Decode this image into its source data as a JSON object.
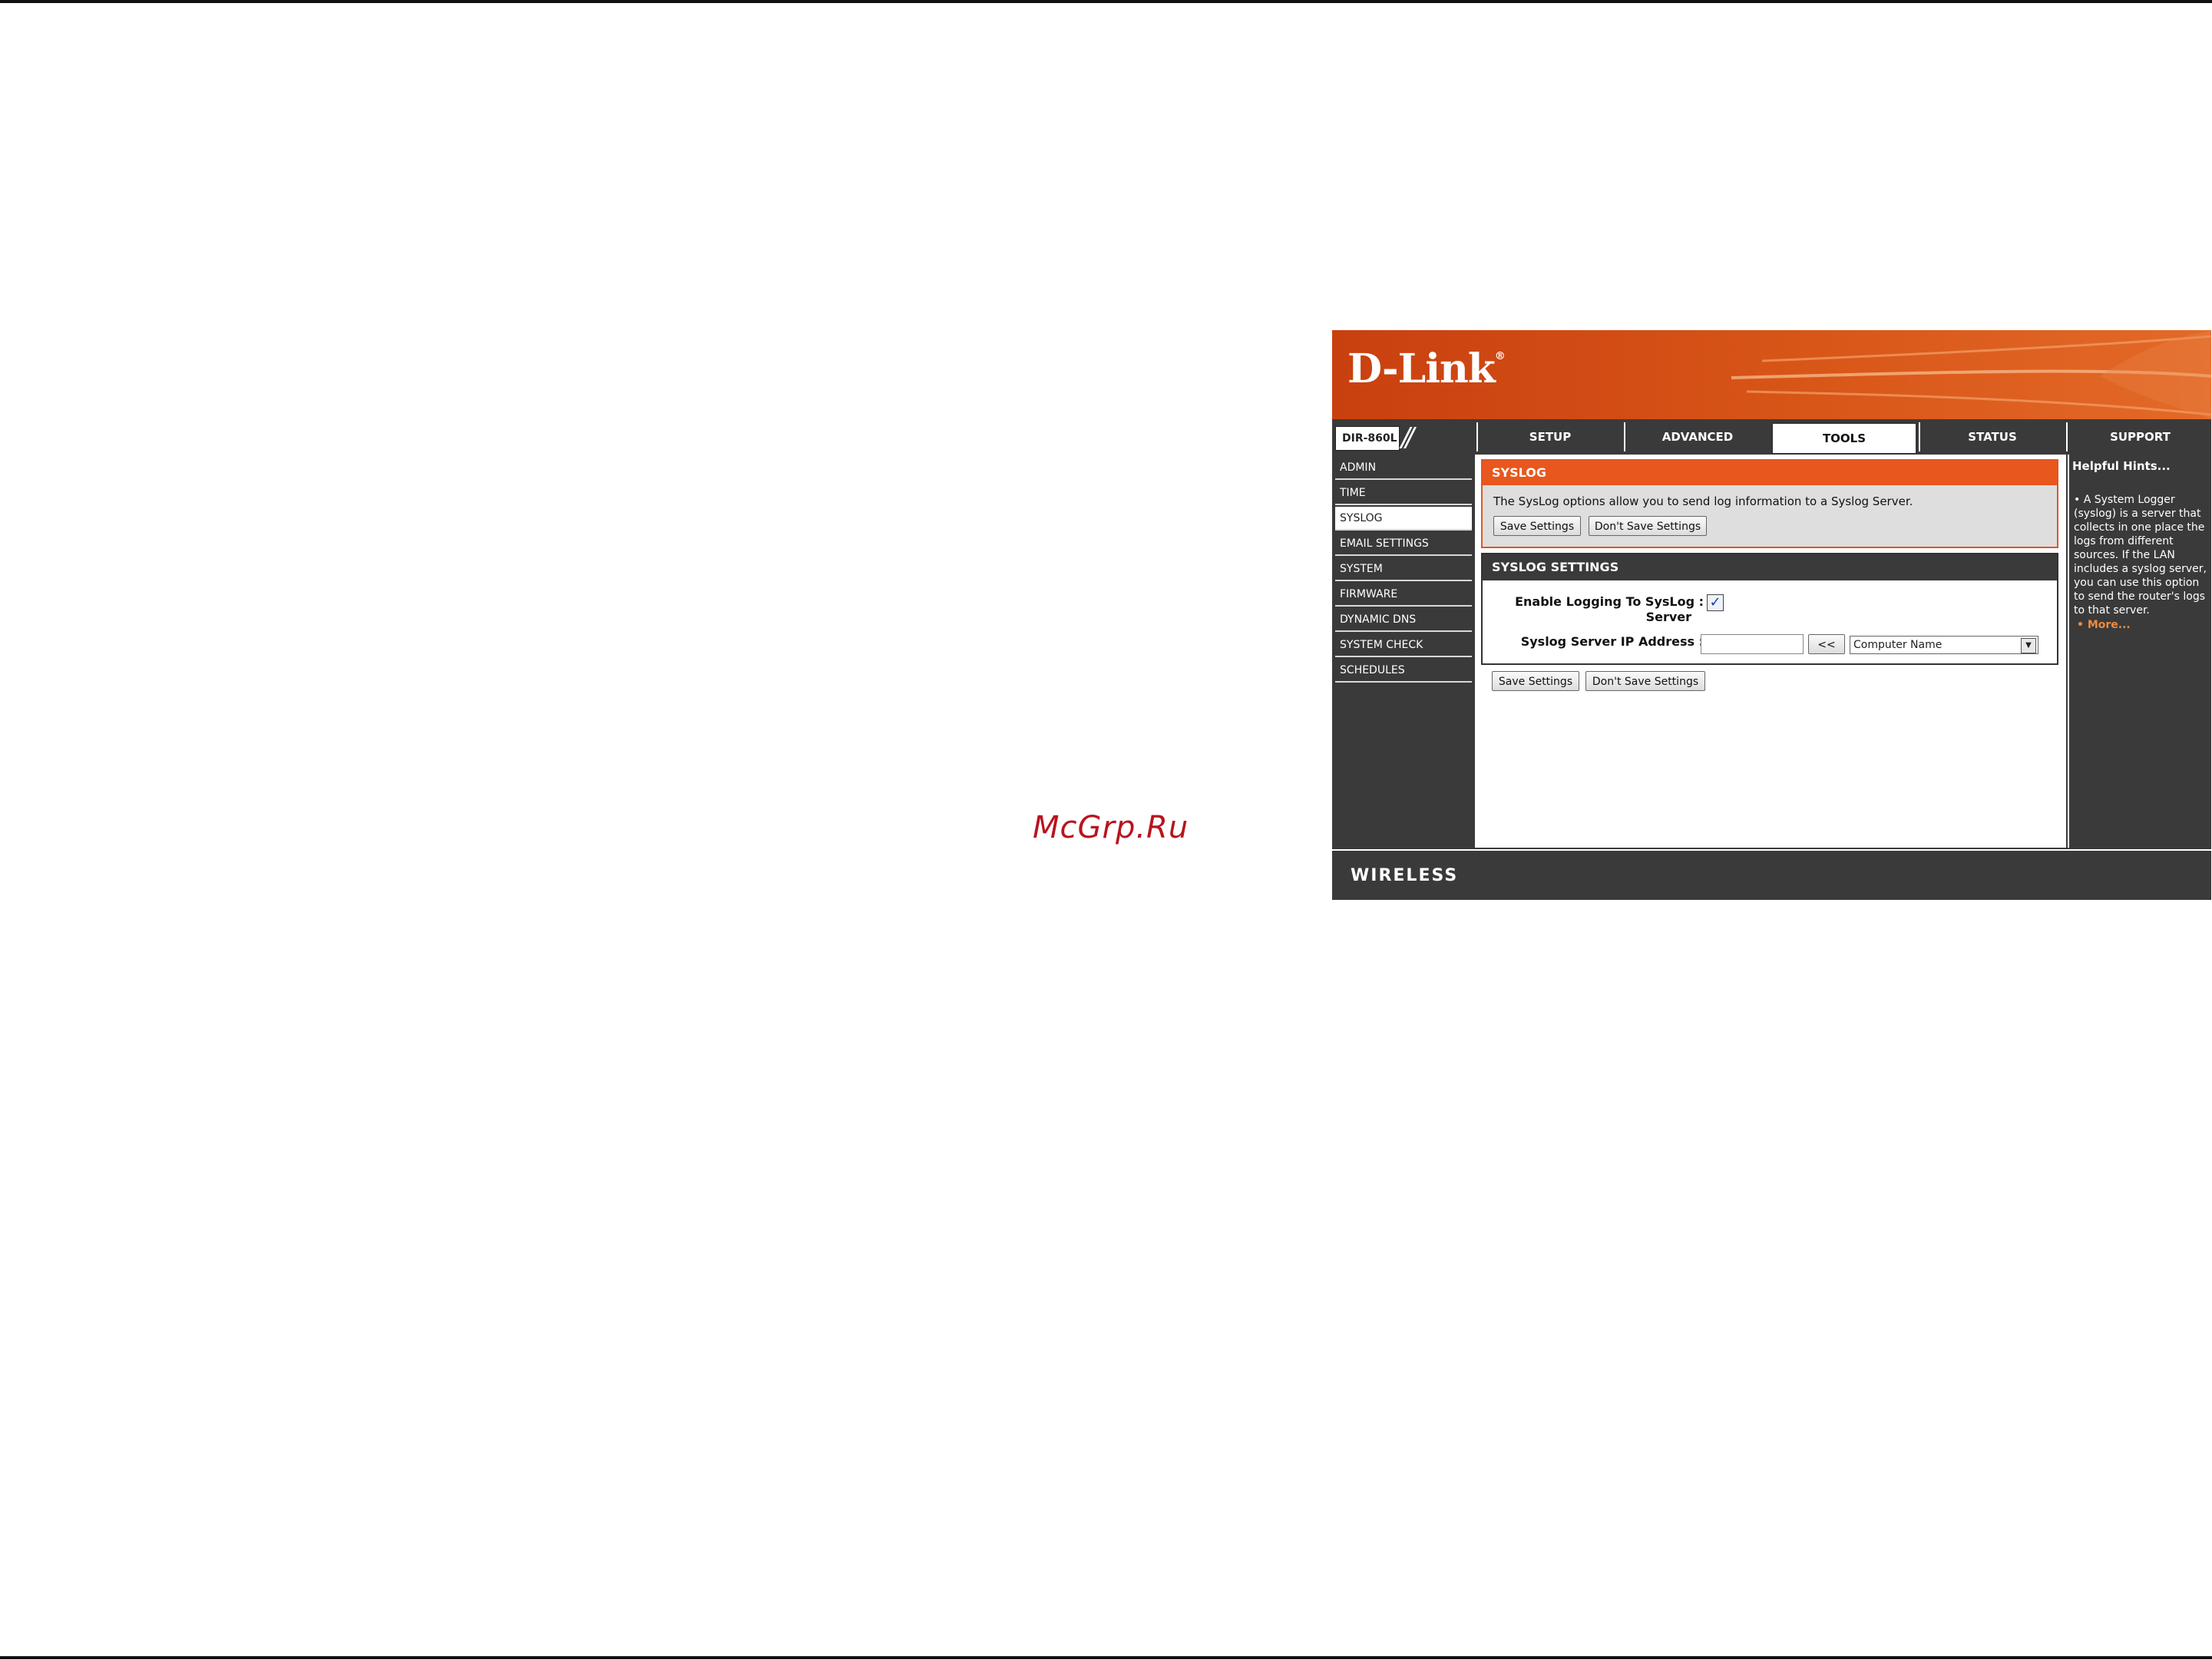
{
  "watermark": "McGrp.Ru",
  "brand": {
    "logo": "D-Link",
    "registered": "®",
    "model": "DIR-860L",
    "footer": "WIRELESS"
  },
  "tabs": [
    {
      "label": "SETUP",
      "active": false
    },
    {
      "label": "ADVANCED",
      "active": false
    },
    {
      "label": "TOOLS",
      "active": true
    },
    {
      "label": "STATUS",
      "active": false
    },
    {
      "label": "SUPPORT",
      "active": false
    }
  ],
  "sidebar": {
    "items": [
      {
        "label": "ADMIN",
        "active": false
      },
      {
        "label": "TIME",
        "active": false
      },
      {
        "label": "SYSLOG",
        "active": true
      },
      {
        "label": "EMAIL SETTINGS",
        "active": false
      },
      {
        "label": "SYSTEM",
        "active": false
      },
      {
        "label": "FIRMWARE",
        "active": false
      },
      {
        "label": "DYNAMIC DNS",
        "active": false
      },
      {
        "label": "SYSTEM CHECK",
        "active": false
      },
      {
        "label": "SCHEDULES",
        "active": false
      }
    ]
  },
  "syslog": {
    "title": "SYSLOG",
    "description": "The SysLog options allow you to send log information to a Syslog Server.",
    "save_label": "Save Settings",
    "dont_save_label": "Don't Save Settings"
  },
  "settings": {
    "title": "SYSLOG SETTINGS",
    "enable_label_1": "Enable Logging To SysLog :",
    "enable_label_2": "Server",
    "enable_checked": true,
    "ip_label": "Syslog Server IP Address :",
    "ip_value": "",
    "copy_button": "<<",
    "computer_select": "Computer Name"
  },
  "bottom_buttons": {
    "save_label": "Save Settings",
    "dont_save_label": "Don't Save Settings"
  },
  "hints": {
    "title": "Helpful Hints...",
    "text": "A System Logger (syslog) is a server that collects in one place the logs from different sources. If the LAN includes a syslog server, you can use this option to send the router's logs to that server.",
    "more": "More..."
  },
  "colors": {
    "accent": "#e8571d",
    "dark": "#3a3a3a",
    "link": "#f08a3c"
  }
}
